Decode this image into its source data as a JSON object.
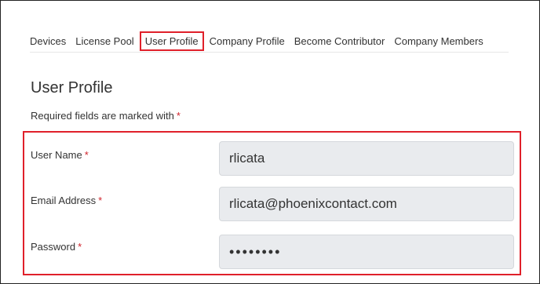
{
  "tabs": [
    {
      "label": "Devices"
    },
    {
      "label": "License Pool"
    },
    {
      "label": "User Profile"
    },
    {
      "label": "Company Profile"
    },
    {
      "label": "Become Contributor"
    },
    {
      "label": "Company Members"
    }
  ],
  "active_tab": "User Profile",
  "page_title": "User Profile",
  "required_note": "Required fields are marked with",
  "required_marker": "*",
  "form": {
    "username": {
      "label": "User Name",
      "value": "rlicata"
    },
    "email": {
      "label": "Email Address",
      "value": "rlicata@phoenixcontact.com"
    },
    "password": {
      "label": "Password",
      "value": "••••••••"
    }
  },
  "colors": {
    "highlight": "#e0202a",
    "required_star": "#d0232b",
    "input_bg": "#e9ebee"
  }
}
